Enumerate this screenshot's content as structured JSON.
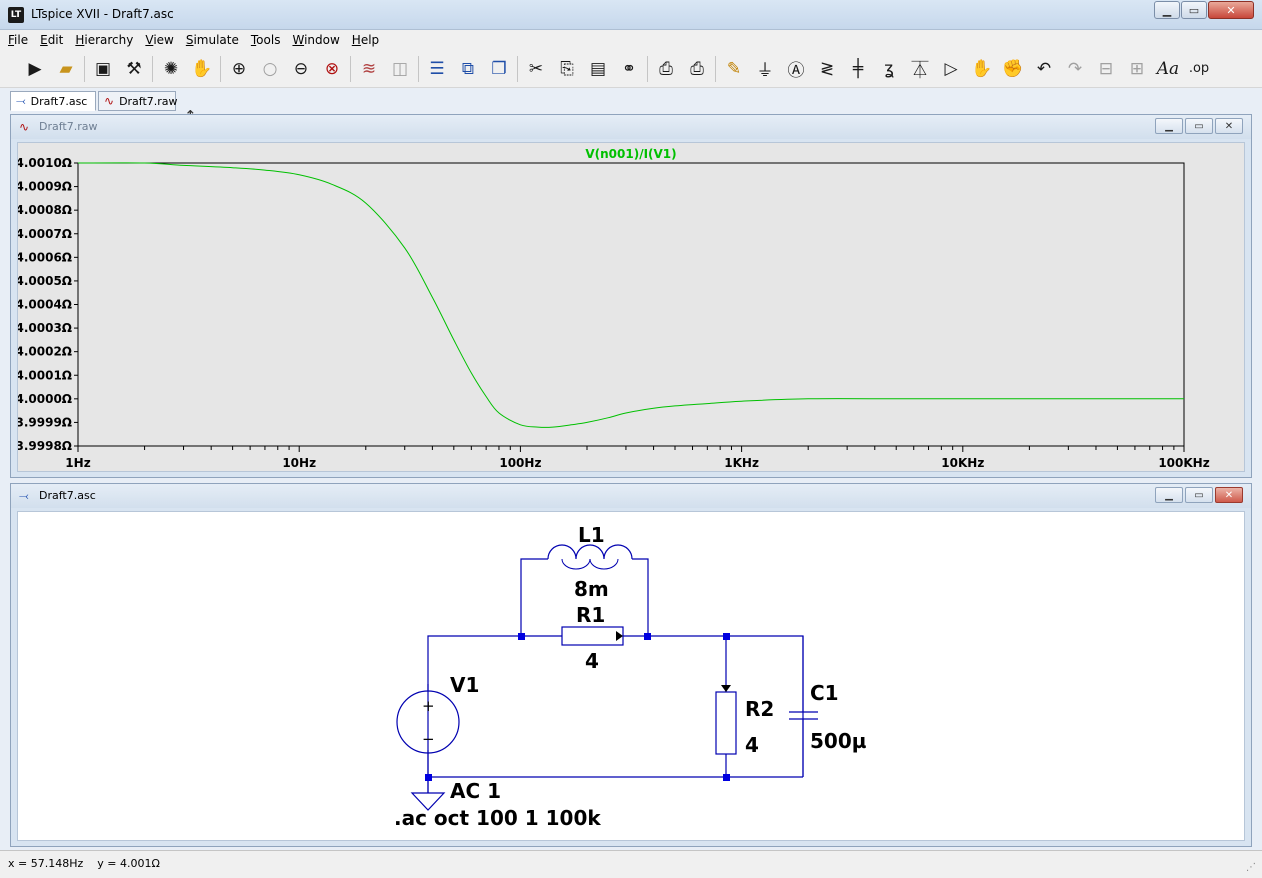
{
  "window": {
    "title": "LTspice XVII - Draft7.asc",
    "app_icon": "LT"
  },
  "menu": [
    {
      "label": "File"
    },
    {
      "label": "Edit"
    },
    {
      "label": "Hierarchy"
    },
    {
      "label": "View"
    },
    {
      "label": "Simulate"
    },
    {
      "label": "Tools"
    },
    {
      "label": "Window"
    },
    {
      "label": "Help"
    }
  ],
  "toolbar": {
    "icons": [
      "run-icon",
      "open-icon",
      "save-icon",
      "control-panel-icon",
      "halt-icon",
      "pan-icon",
      "zoom-in-icon",
      "zoom-pan-icon",
      "zoom-out-icon",
      "zoom-fit-icon",
      "autorange-icon",
      "add-plot-pane-icon",
      "tile-horizontal-icon",
      "tile-vertical-icon",
      "cascade-icon",
      "cut-icon",
      "copy-icon",
      "paste-icon",
      "find-icon",
      "print-preview-icon",
      "print-icon",
      "wire-icon",
      "ground-icon",
      "label-net-icon",
      "resistor-icon",
      "capacitor-icon",
      "inductor-icon",
      "diode-icon",
      "component-icon",
      "move-icon",
      "drag-icon",
      "undo-icon",
      "redo-icon",
      "rotate-icon",
      "mirror-icon",
      "text-icon",
      "spice-directive-icon"
    ]
  },
  "tabs": [
    {
      "label": "Draft7.asc",
      "active": true
    },
    {
      "label": "Draft7.raw",
      "active": false
    }
  ],
  "waveform_window": {
    "title": "Draft7.raw"
  },
  "schematic_window": {
    "title": "Draft7.asc",
    "components": {
      "L1": {
        "name": "L1",
        "value": "8m"
      },
      "R1": {
        "name": "R1",
        "value": "4"
      },
      "R2": {
        "name": "R2",
        "value": "4"
      },
      "C1": {
        "name": "C1",
        "value": "500µ"
      },
      "V1": {
        "name": "V1",
        "value": "AC 1"
      }
    },
    "directive": ".ac oct 100 1 100k"
  },
  "chart_data": {
    "type": "line",
    "title": "V(n001)/I(V1)",
    "x_scale": "log",
    "xlim": [
      1,
      100000
    ],
    "ylim": [
      3.9998,
      4.001
    ],
    "x_ticks": [
      "1Hz",
      "10Hz",
      "100Hz",
      "1KHz",
      "10KHz",
      "100KHz"
    ],
    "y_ticks": [
      "4.0010Ω",
      "4.0009Ω",
      "4.0008Ω",
      "4.0007Ω",
      "4.0006Ω",
      "4.0005Ω",
      "4.0004Ω",
      "4.0003Ω",
      "4.0002Ω",
      "4.0001Ω",
      "4.0000Ω",
      "3.9999Ω",
      "3.9998Ω"
    ],
    "grid": false,
    "series": [
      {
        "name": "V(n001)/I(V1)",
        "color": "#00c000",
        "x": [
          1,
          2,
          3,
          5,
          7,
          10,
          14,
          20,
          30,
          40,
          50,
          60,
          70,
          80,
          100,
          120,
          140,
          170,
          200,
          250,
          300,
          400,
          500,
          700,
          1000,
          2000,
          5000,
          10000,
          100000
        ],
        "y": [
          4.001,
          4.001,
          4.00099,
          4.00098,
          4.00097,
          4.00095,
          4.00091,
          4.00083,
          4.00064,
          4.00043,
          4.00025,
          4.00011,
          4.00001,
          3.99994,
          3.99989,
          3.99988,
          3.99988,
          3.99989,
          3.9999,
          3.99992,
          3.99994,
          3.99996,
          3.99997,
          3.99998,
          3.99999,
          4.0,
          4.0,
          4.0,
          4.0
        ]
      }
    ]
  },
  "status": {
    "text": "x = 57.148Hz    y = 4.001Ω"
  }
}
